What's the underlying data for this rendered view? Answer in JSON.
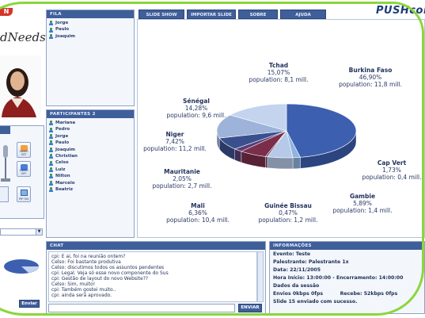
{
  "brand": {
    "partial_left": "N",
    "partial_tagline": "dNeeds",
    "logo": "PUSHcom"
  },
  "tabs": [
    {
      "label": "SLIDE SHOW"
    },
    {
      "label": "IMPORTAR SLIDE"
    },
    {
      "label": "SOBRE"
    },
    {
      "label": "AJUDA"
    }
  ],
  "fila": {
    "title": "FILA",
    "users": [
      "Jorge",
      "Paulo",
      "Joaquim"
    ]
  },
  "participantes": {
    "title": "PARTICIPANTES",
    "count": "2",
    "users": [
      "Mariana",
      "Pedro",
      "Jorge",
      "Paulo",
      "Joaquim",
      "Christian",
      "Celso",
      "Luiz",
      "Nilton",
      "Marcelo",
      "Beatriz"
    ]
  },
  "left_controls": {
    "video_buttons": [
      {
        "label": "VIDEO OFF"
      },
      {
        "label": "VIDEO OFF"
      },
      {
        "label": "PIP ON"
      }
    ],
    "send_button": "Enviar"
  },
  "chart_data": {
    "type": "pie",
    "slices": [
      {
        "name": "Burkina Faso",
        "percent": "46,90%",
        "population": "population: 11,8 mill.",
        "value": 46.9,
        "color": "#3d5fb0"
      },
      {
        "name": "Cap Vert",
        "percent": "1,73%",
        "population": "population: 0,4 mill.",
        "value": 1.73,
        "color": "#8fb4e0"
      },
      {
        "name": "Gambie",
        "percent": "5,89%",
        "population": "population: 1,4 mill.",
        "value": 5.89,
        "color": "#b6c9e8"
      },
      {
        "name": "Guinée Bissau",
        "percent": "0,47%",
        "population": "population: 1,2 mill.",
        "value": 0.47,
        "color": "#6b3a5c"
      },
      {
        "name": "Mali",
        "percent": "6,36%",
        "population": "population: 10,4 mill.",
        "value": 6.36,
        "color": "#7a2e4a"
      },
      {
        "name": "Mauritanie",
        "percent": "2,05%",
        "population": "population: 2,7 mill.",
        "value": 2.05,
        "color": "#5a3e78"
      },
      {
        "name": "Niger",
        "percent": "7,42%",
        "population": "population: 11,2 mill.",
        "value": 7.42,
        "color": "#3a4f8e"
      },
      {
        "name": "Sénégal",
        "percent": "14,28%",
        "population": "population: 9,6 mill.",
        "value": 14.28,
        "color": "#9db3d9"
      },
      {
        "name": "Tchad",
        "percent": "15,07%",
        "population": "population: 8,1 mill.",
        "value": 15.07,
        "color": "#c4d4ef"
      }
    ]
  },
  "chat": {
    "title": "CHAT",
    "lines": [
      "cpi: E ai, foi na reunião ontem?",
      "Celso: Foi bastante produtiva",
      "Celso: discutimos todos os assuntos pendentes",
      "cpi: Legal. Veja só esse novo componente do Sus",
      "cpi: Gestão de layout do novo Website??",
      "Celso: Sim, muito!",
      "cpi: Também gostei muito..",
      "cpi: ainda será aprovado."
    ],
    "send_button": "ENVIAR"
  },
  "info": {
    "title": "INFORMAÇÕES",
    "lines": [
      "Evento: Teste",
      "Palestrante: Palestrante 1x",
      "Data: 22/11/2005",
      "Hora Início: 13:00:00 - Encerramento: 14:00:00",
      "Dados da sessão",
      "Envios 0kbps 0fps          Recebe: 52kbps 0fps",
      "Slide 15 enviado com sucesso."
    ]
  }
}
